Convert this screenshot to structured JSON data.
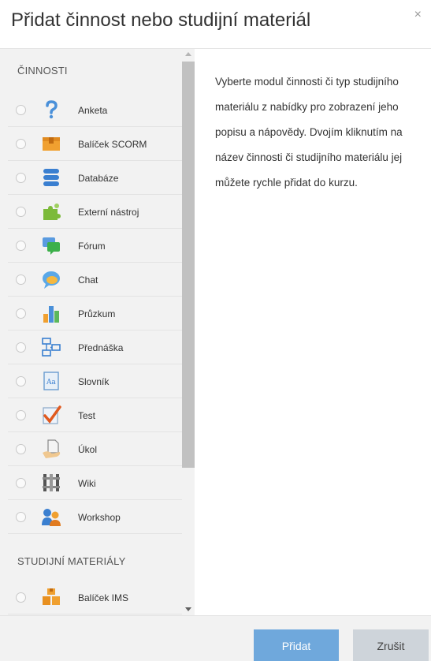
{
  "dialog": {
    "title": "Přidat činnost nebo studijní materiál",
    "close_symbol": "×"
  },
  "sections": {
    "activities_title": "ČINNOSTI",
    "resources_title": "STUDIJNÍ MATERIÁLY"
  },
  "activities": [
    {
      "label": "Anketa",
      "icon": "question-icon"
    },
    {
      "label": "Balíček SCORM",
      "icon": "package-icon"
    },
    {
      "label": "Databáze",
      "icon": "database-icon"
    },
    {
      "label": "Externí nástroj",
      "icon": "puzzle-icon"
    },
    {
      "label": "Fórum",
      "icon": "forum-icon"
    },
    {
      "label": "Chat",
      "icon": "chat-icon"
    },
    {
      "label": "Průzkum",
      "icon": "bar-chart-icon"
    },
    {
      "label": "Přednáška",
      "icon": "flowchart-icon"
    },
    {
      "label": "Slovník",
      "icon": "dictionary-icon"
    },
    {
      "label": "Test",
      "icon": "checkmark-icon"
    },
    {
      "label": "Úkol",
      "icon": "assignment-icon"
    },
    {
      "label": "Wiki",
      "icon": "wiki-icon"
    },
    {
      "label": "Workshop",
      "icon": "workshop-icon"
    }
  ],
  "resources": [
    {
      "label": "Balíček IMS",
      "icon": "ims-package-icon"
    }
  ],
  "description": "Vyberte modul činnosti či typ studijního materiálu z nabídky pro zobrazení jeho popisu a nápovědy. Dvojím kliknutím na název činnosti či studijního materiálu jej můžete rychle přidat do kurzu.",
  "footer": {
    "add_label": "Přidat",
    "cancel_label": "Zrušit"
  },
  "colors": {
    "primary_button": "#6fa8dc",
    "secondary_button": "#ced4da",
    "panel_bg": "#f2f2f2"
  }
}
